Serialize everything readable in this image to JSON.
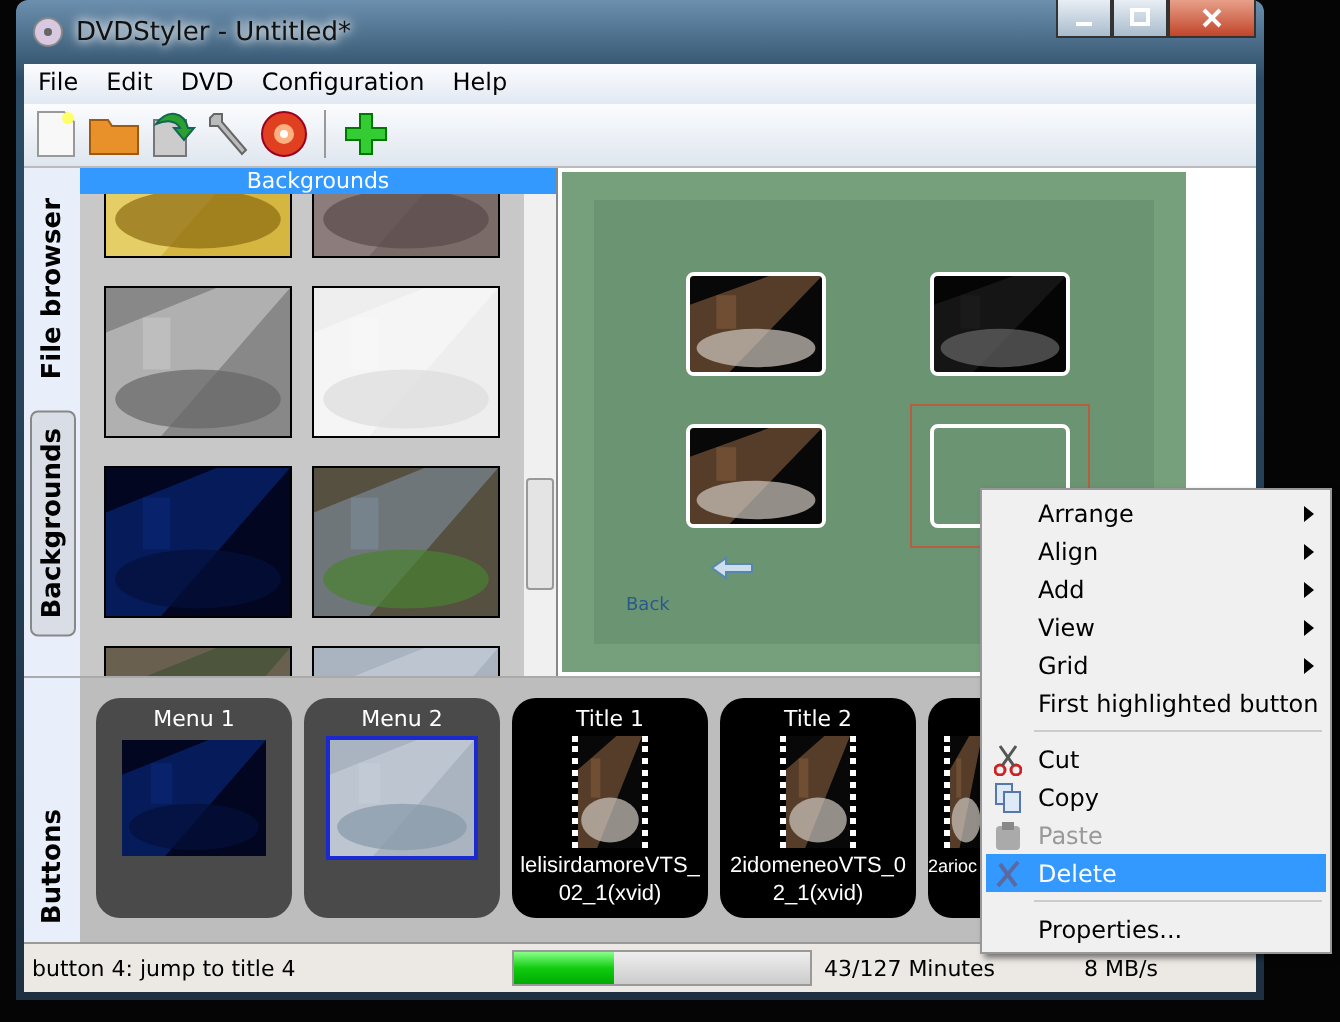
{
  "window": {
    "title": "DVDStyler - Untitled*"
  },
  "menu": [
    "File",
    "Edit",
    "DVD",
    "Configuration",
    "Help"
  ],
  "side_tabs": [
    {
      "label": "File browser",
      "selected": false
    },
    {
      "label": "Backgrounds",
      "selected": true
    },
    {
      "label": "Buttons",
      "selected": false
    }
  ],
  "backgrounds_panel": {
    "title": "Backgrounds"
  },
  "canvas": {
    "back_label": "Back",
    "buttons": [
      {
        "kind": "picture",
        "selected": false
      },
      {
        "kind": "picture",
        "selected": false
      },
      {
        "kind": "picture",
        "selected": false
      },
      {
        "kind": "empty",
        "selected": true
      }
    ]
  },
  "menus_and_titles": [
    {
      "kind": "menu",
      "title": "Menu 1",
      "selected": false
    },
    {
      "kind": "menu",
      "title": "Menu 2",
      "selected": true
    },
    {
      "kind": "title",
      "title": "Title 1",
      "caption": "lelisirdamoreVTS_02_1(xvid)",
      "selected": false
    },
    {
      "kind": "title",
      "title": "Title 2",
      "caption": "2idomeneoVTS_02_1(xvid)",
      "selected": false
    },
    {
      "kind": "title",
      "caption": "2arioc",
      "selected": false
    }
  ],
  "status_bar": {
    "message": "button 4: jump to title 4",
    "disc_usage": {
      "level": 0.34
    },
    "minutes": "43/127 Minutes",
    "speed": "8 MB/s"
  },
  "context_menu": [
    {
      "kind": "submenu",
      "label": "Arrange",
      "disabled": false,
      "selected": false
    },
    {
      "kind": "submenu",
      "label": "Align",
      "disabled": false,
      "selected": false
    },
    {
      "kind": "submenu",
      "label": "Add",
      "disabled": false,
      "selected": false
    },
    {
      "kind": "submenu",
      "label": "View",
      "disabled": false,
      "selected": false
    },
    {
      "kind": "submenu",
      "label": "Grid",
      "disabled": false,
      "selected": false
    },
    {
      "kind": "item",
      "label": "First highlighted button",
      "disabled": false,
      "selected": false
    },
    {
      "kind": "separator"
    },
    {
      "kind": "cut",
      "label": "Cut",
      "disabled": false,
      "selected": false
    },
    {
      "kind": "copy",
      "label": "Copy",
      "disabled": false,
      "selected": false
    },
    {
      "kind": "paste",
      "label": "Paste",
      "disabled": true,
      "selected": false
    },
    {
      "kind": "delete",
      "label": "Delete",
      "disabled": false,
      "selected": true
    },
    {
      "kind": "separator"
    },
    {
      "kind": "item",
      "label": "Properties...",
      "disabled": false,
      "selected": false
    }
  ]
}
